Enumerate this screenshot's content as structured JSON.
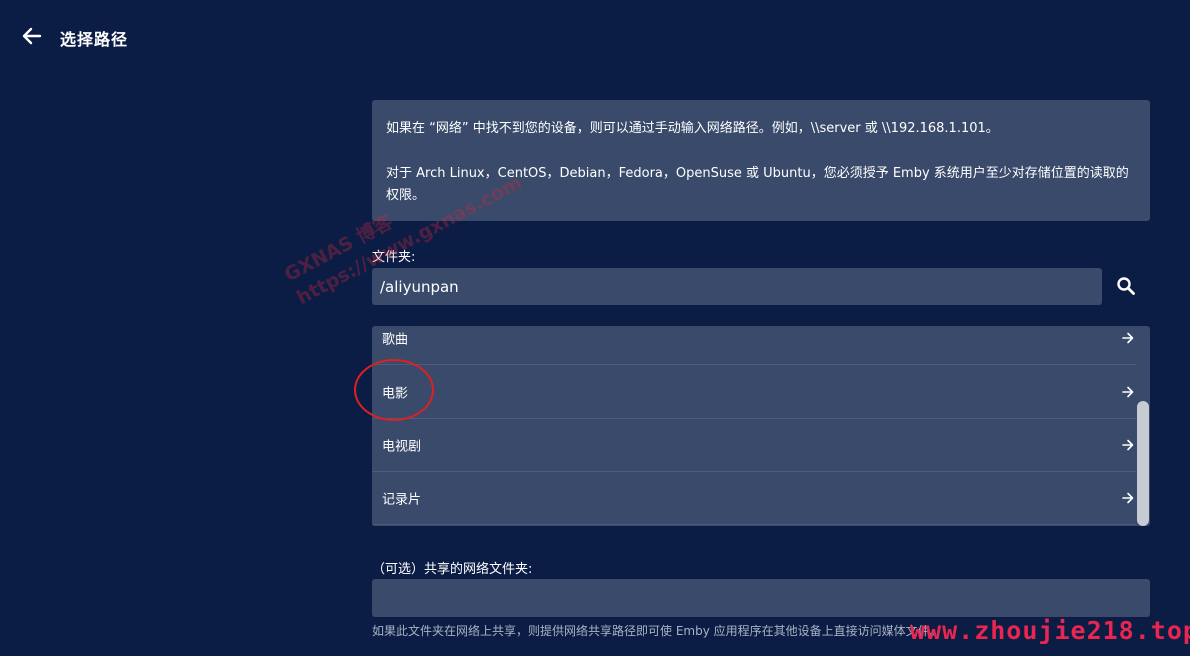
{
  "header": {
    "back_icon": "arrow-left-icon",
    "title": "选择路径"
  },
  "info": {
    "line1": "如果在 “网络” 中找不到您的设备，则可以通过手动输入网络路径。例如，\\\\server 或 \\\\192.168.1.101。",
    "line2": "对于 Arch Linux，CentOS，Debian，Fedora，OpenSuse 或 Ubuntu，您必须授予 Emby 系统用户至少对存储位置的读取的权限。"
  },
  "folder": {
    "label": "文件夹:",
    "value": "/aliyunpan",
    "search_icon": "search-icon"
  },
  "directories": [
    {
      "label": "歌曲",
      "icon": "arrow-right-icon"
    },
    {
      "label": "电影",
      "icon": "arrow-right-icon"
    },
    {
      "label": "电视剧",
      "icon": "arrow-right-icon"
    },
    {
      "label": "记录片",
      "icon": "arrow-right-icon"
    }
  ],
  "share": {
    "label": "（可选）共享的网络文件夹:",
    "value": "",
    "help": "如果此文件夹在网络上共享，则提供网络共享路径即可使 Emby 应用程序在其他设备上直接访问媒体文件。"
  },
  "watermarks": {
    "site": "www.zhoujie218.top",
    "diagonal": "GXNAS 博客\nhttps://www.gxnas.com"
  },
  "colors": {
    "background": "#0c1d45",
    "panel": "#3a4a6b",
    "annotation": "#e02020",
    "watermark": "#e8264f"
  }
}
